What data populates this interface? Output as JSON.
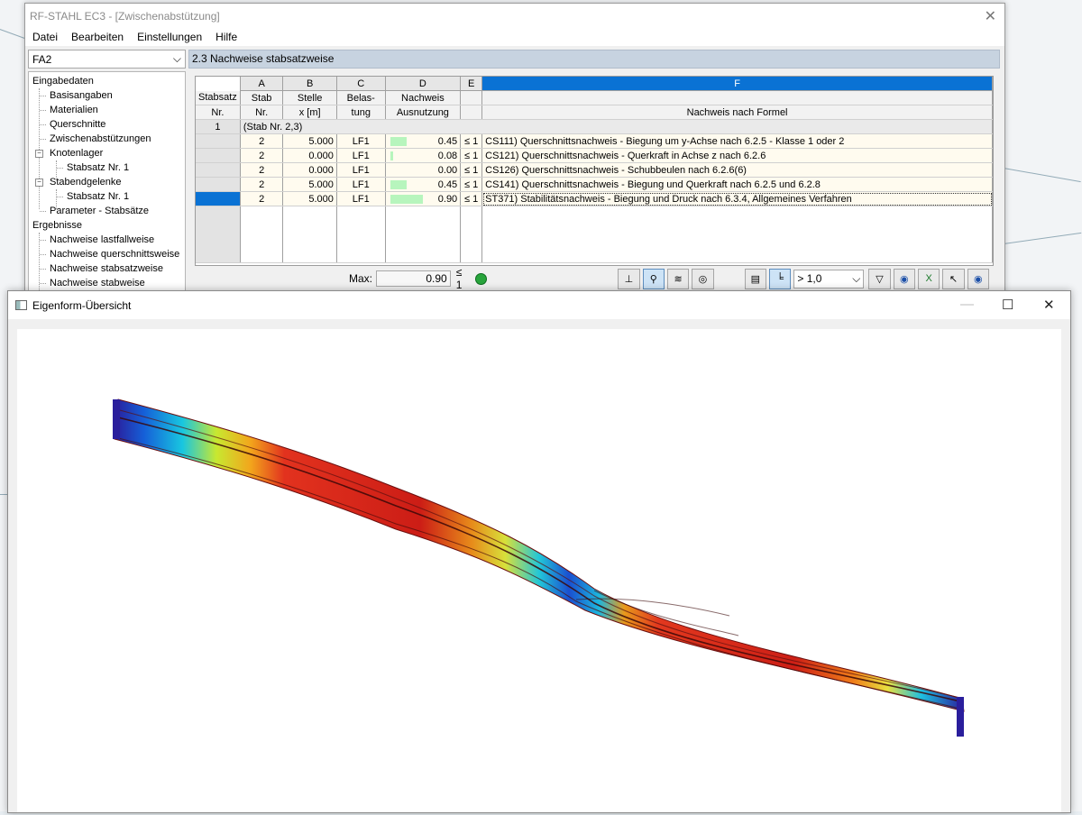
{
  "main_window": {
    "title": "RF-STAHL EC3 - [Zwischenabstützung]",
    "menu": [
      "Datei",
      "Bearbeiten",
      "Einstellungen",
      "Hilfe"
    ],
    "case_select": "FA2",
    "tree": {
      "eingabedaten": "Eingabedaten",
      "basisangaben": "Basisangaben",
      "materialien": "Materialien",
      "querschnitte": "Querschnitte",
      "zwischenabstuetzungen": "Zwischenabstützungen",
      "knotenlager": "Knotenlager",
      "knotenlager_child": "Stabsatz Nr. 1",
      "stabendgelenke": "Stabendgelenke",
      "stabendgelenke_child": "Stabsatz Nr. 1",
      "parameter": "Parameter - Stabsätze",
      "ergebnisse": "Ergebnisse",
      "nachweise_lastfall": "Nachweise lastfallweise",
      "nachweise_querschnitt": "Nachweise querschnittsweise",
      "nachweise_stabsatz": "Nachweise stabsatzweise",
      "nachweise_stab": "Nachweise stabweise"
    },
    "section_title": "2.3 Nachweise stabsatzweise",
    "column_letters": [
      "A",
      "B",
      "C",
      "D",
      "E",
      "F"
    ],
    "headers": {
      "stabsatz_top": "Stabsatz",
      "stabsatz_bottom": "Nr.",
      "stab_top": "Stab",
      "stab_bottom": "Nr.",
      "stelle_top": "Stelle",
      "stelle_bottom": "x [m]",
      "belas_top": "Belas-",
      "belas_bottom": "tung",
      "nachweis_top": "Nachweis",
      "nachweis_bottom": "Ausnutzung",
      "formel": "Nachweis nach Formel"
    },
    "group_row": {
      "nr": "1",
      "label": "(Stab Nr. 2,3)"
    },
    "rows": [
      {
        "stab": "2",
        "x": "5.000",
        "lf": "LF1",
        "ratio": "0.45",
        "fill": 0.45,
        "le": "≤ 1",
        "formel": "CS111) Querschnittsnachweis - Biegung um y-Achse nach 6.2.5 - Klasse 1 oder 2"
      },
      {
        "stab": "2",
        "x": "0.000",
        "lf": "LF1",
        "ratio": "0.08",
        "fill": 0.08,
        "le": "≤ 1",
        "formel": "CS121) Querschnittsnachweis - Querkraft in Achse z nach 6.2.6"
      },
      {
        "stab": "2",
        "x": "0.000",
        "lf": "LF1",
        "ratio": "0.00",
        "fill": 0.0,
        "le": "≤ 1",
        "formel": "CS126) Querschnittsnachweis - Schubbeulen nach 6.2.6(6)"
      },
      {
        "stab": "2",
        "x": "5.000",
        "lf": "LF1",
        "ratio": "0.45",
        "fill": 0.45,
        "le": "≤ 1",
        "formel": "CS141) Querschnittsnachweis - Biegung und Querkraft nach 6.2.5 und 6.2.8"
      },
      {
        "stab": "2",
        "x": "5.000",
        "lf": "LF1",
        "ratio": "0.90",
        "fill": 0.9,
        "le": "≤ 1",
        "formel": "ST371) Stabilitätsnachweis - Biegung und Druck nach 6.3.4, Allgemeines Verfahren"
      }
    ],
    "footer": {
      "max_label": "Max:",
      "max_value": "0.90",
      "max_le": "≤ 1",
      "filter_value": "> 1,0"
    }
  },
  "eigen_window": {
    "title": "Eigenform-Übersicht"
  },
  "colors": {
    "selection": "#0a72d4",
    "section_header": "#c7d3e0",
    "row_bg": "#fffbef",
    "ratio_bar": "#b7f5bd"
  }
}
